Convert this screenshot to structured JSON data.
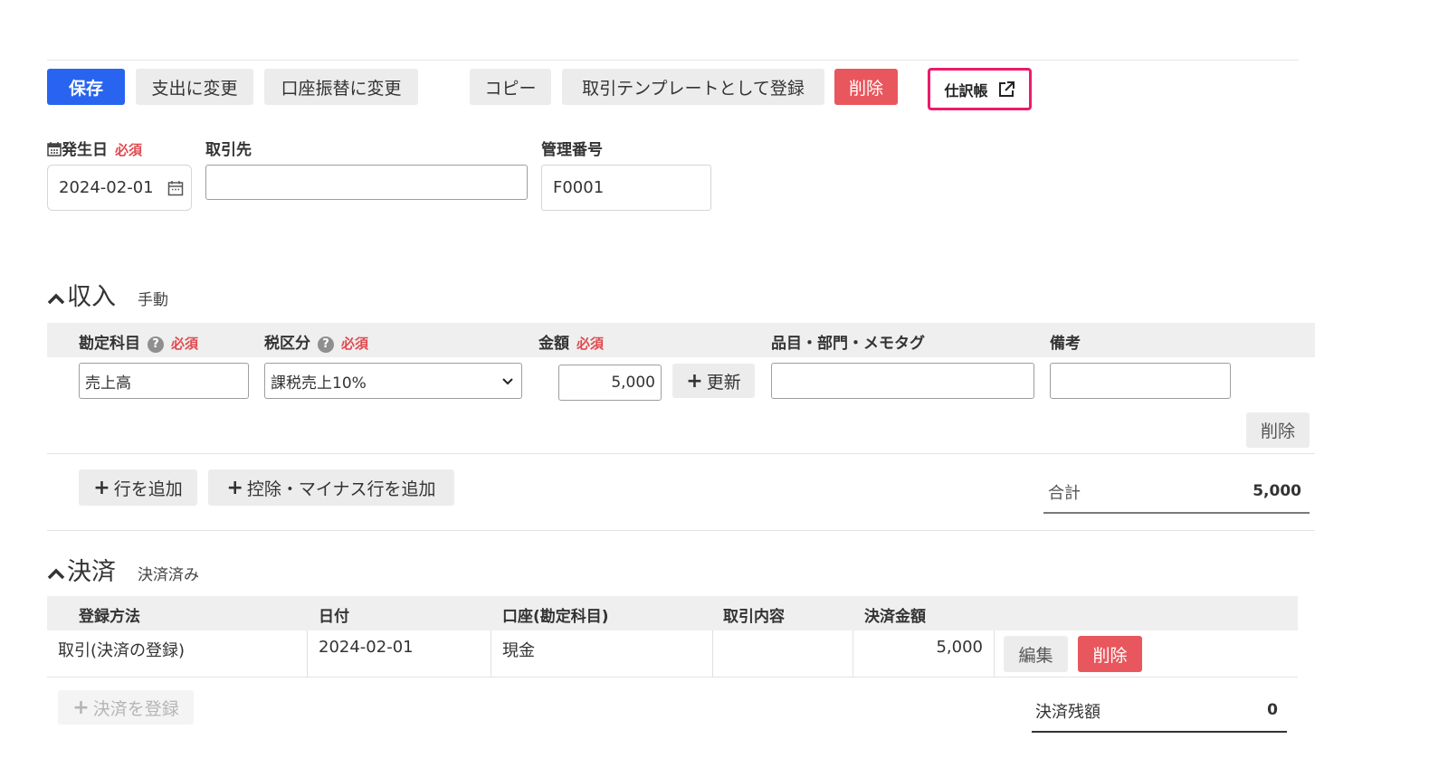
{
  "toolbar": {
    "save": "保存",
    "to_expense": "支出に変更",
    "to_transfer": "口座振替に変更",
    "copy": "コピー",
    "register_template": "取引テンプレートとして登録",
    "delete": "削除",
    "journal": "仕訳帳"
  },
  "header": {
    "date_label": "発生日",
    "required": "必須",
    "date_value": "2024-02-01",
    "partner_label": "取引先",
    "partner_value": "",
    "mgmt_label": "管理番号",
    "mgmt_value": "F0001"
  },
  "income": {
    "title": "収入",
    "mode": "手動",
    "columns": {
      "account": "勘定科目",
      "tax": "税区分",
      "amount": "金額",
      "items": "品目・部門・メモタグ",
      "remarks": "備考"
    },
    "row": {
      "account": "売上高",
      "tax": "課税売上10%",
      "amount": "5,000",
      "update": "更新",
      "items": "",
      "remarks": "",
      "delete": "削除"
    },
    "add_row": "行を追加",
    "add_deduction": "控除・マイナス行を追加",
    "total_label": "合計",
    "total_value": "5,000"
  },
  "settlement": {
    "title": "決済",
    "status": "決済済み",
    "columns": {
      "method": "登録方法",
      "date": "日付",
      "account": "口座(勘定科目)",
      "content": "取引内容",
      "amount": "決済金額"
    },
    "row": {
      "method": "取引(決済の登録)",
      "date": "2024-02-01",
      "account": "現金",
      "content": "",
      "amount": "5,000",
      "edit": "編集",
      "delete": "削除"
    },
    "register": "決済を登録",
    "balance_label": "決済残額",
    "balance_value": "0"
  }
}
